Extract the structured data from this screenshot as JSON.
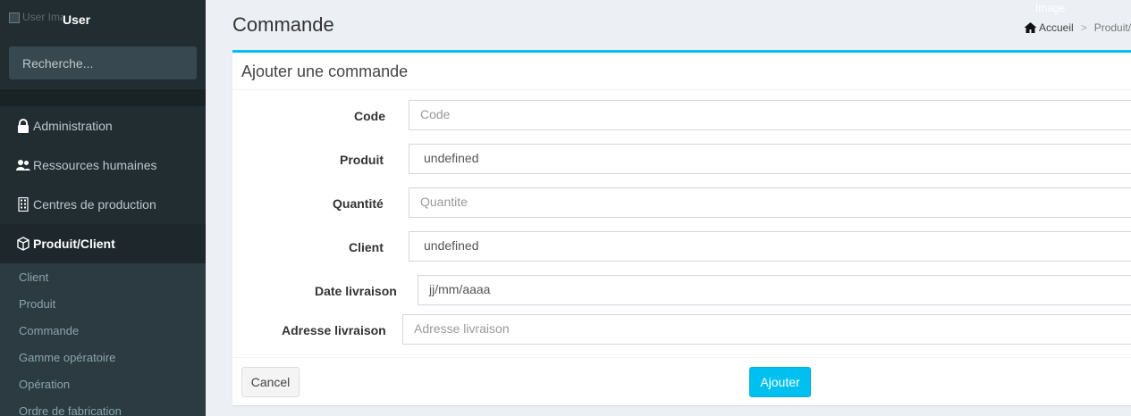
{
  "sidebar": {
    "user_image_alt": "User Image",
    "user_name": "User",
    "search_placeholder": "Recherche...",
    "menu": [
      {
        "label": "Administration",
        "icon": "lock-icon"
      },
      {
        "label": "Ressources humaines",
        "icon": "users-icon"
      },
      {
        "label": "Centres de production",
        "icon": "building-icon"
      },
      {
        "label": "Produit/Client",
        "icon": "cube-icon",
        "active": true
      }
    ],
    "submenu": [
      {
        "label": "Client"
      },
      {
        "label": "Produit"
      },
      {
        "label": "Commande"
      },
      {
        "label": "Gamme opératoire"
      },
      {
        "label": "Opération"
      },
      {
        "label": "Ordre de fabrication"
      }
    ]
  },
  "header": {
    "title": "Commande",
    "image_alt": "Image",
    "breadcrumb": {
      "home": "Accueil",
      "current": "Produit/C"
    }
  },
  "form": {
    "title": "Ajouter une commande",
    "fields": [
      {
        "label": "Code",
        "value": "",
        "placeholder": "Code"
      },
      {
        "label": "Produit",
        "value": "undefined",
        "placeholder": ""
      },
      {
        "label": "Quantité",
        "value": "",
        "placeholder": "Quantite"
      },
      {
        "label": "Client",
        "value": "undefined",
        "placeholder": ""
      },
      {
        "label": "Date livraison",
        "value": "jj/mm/aaaa",
        "placeholder": ""
      },
      {
        "label": "Adresse livraison",
        "value": "",
        "placeholder": "Adresse livraison"
      }
    ],
    "cancel_label": "Cancel",
    "submit_label": "Ajouter"
  },
  "colors": {
    "sidebar_bg": "#222d32",
    "accent": "#00c0ef",
    "content_bg": "#ecf0f5"
  }
}
